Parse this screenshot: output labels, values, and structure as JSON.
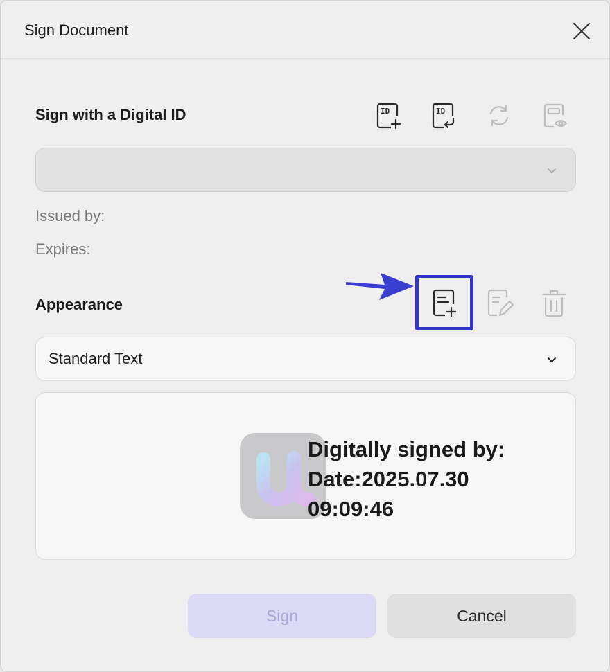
{
  "dialog": {
    "title": "Sign Document"
  },
  "digital_id": {
    "heading": "Sign with a Digital ID",
    "selected": "",
    "issued_by_label": "Issued by:",
    "expires_label": "Expires:",
    "icons": [
      "add-id-icon",
      "import-id-icon",
      "refresh-icon",
      "view-id-icon"
    ]
  },
  "appearance": {
    "heading": "Appearance",
    "selected": "Standard Text",
    "icons": [
      "new-appearance-icon",
      "edit-appearance-icon",
      "delete-icon"
    ],
    "preview_lines": [
      "Digitally signed by:",
      "Date:2025.07.30",
      "09:09:46"
    ]
  },
  "buttons": {
    "sign": "Sign",
    "cancel": "Cancel"
  },
  "colors": {
    "highlight": "#3436c8",
    "sign_button_disabled": "#dcdaf4"
  }
}
